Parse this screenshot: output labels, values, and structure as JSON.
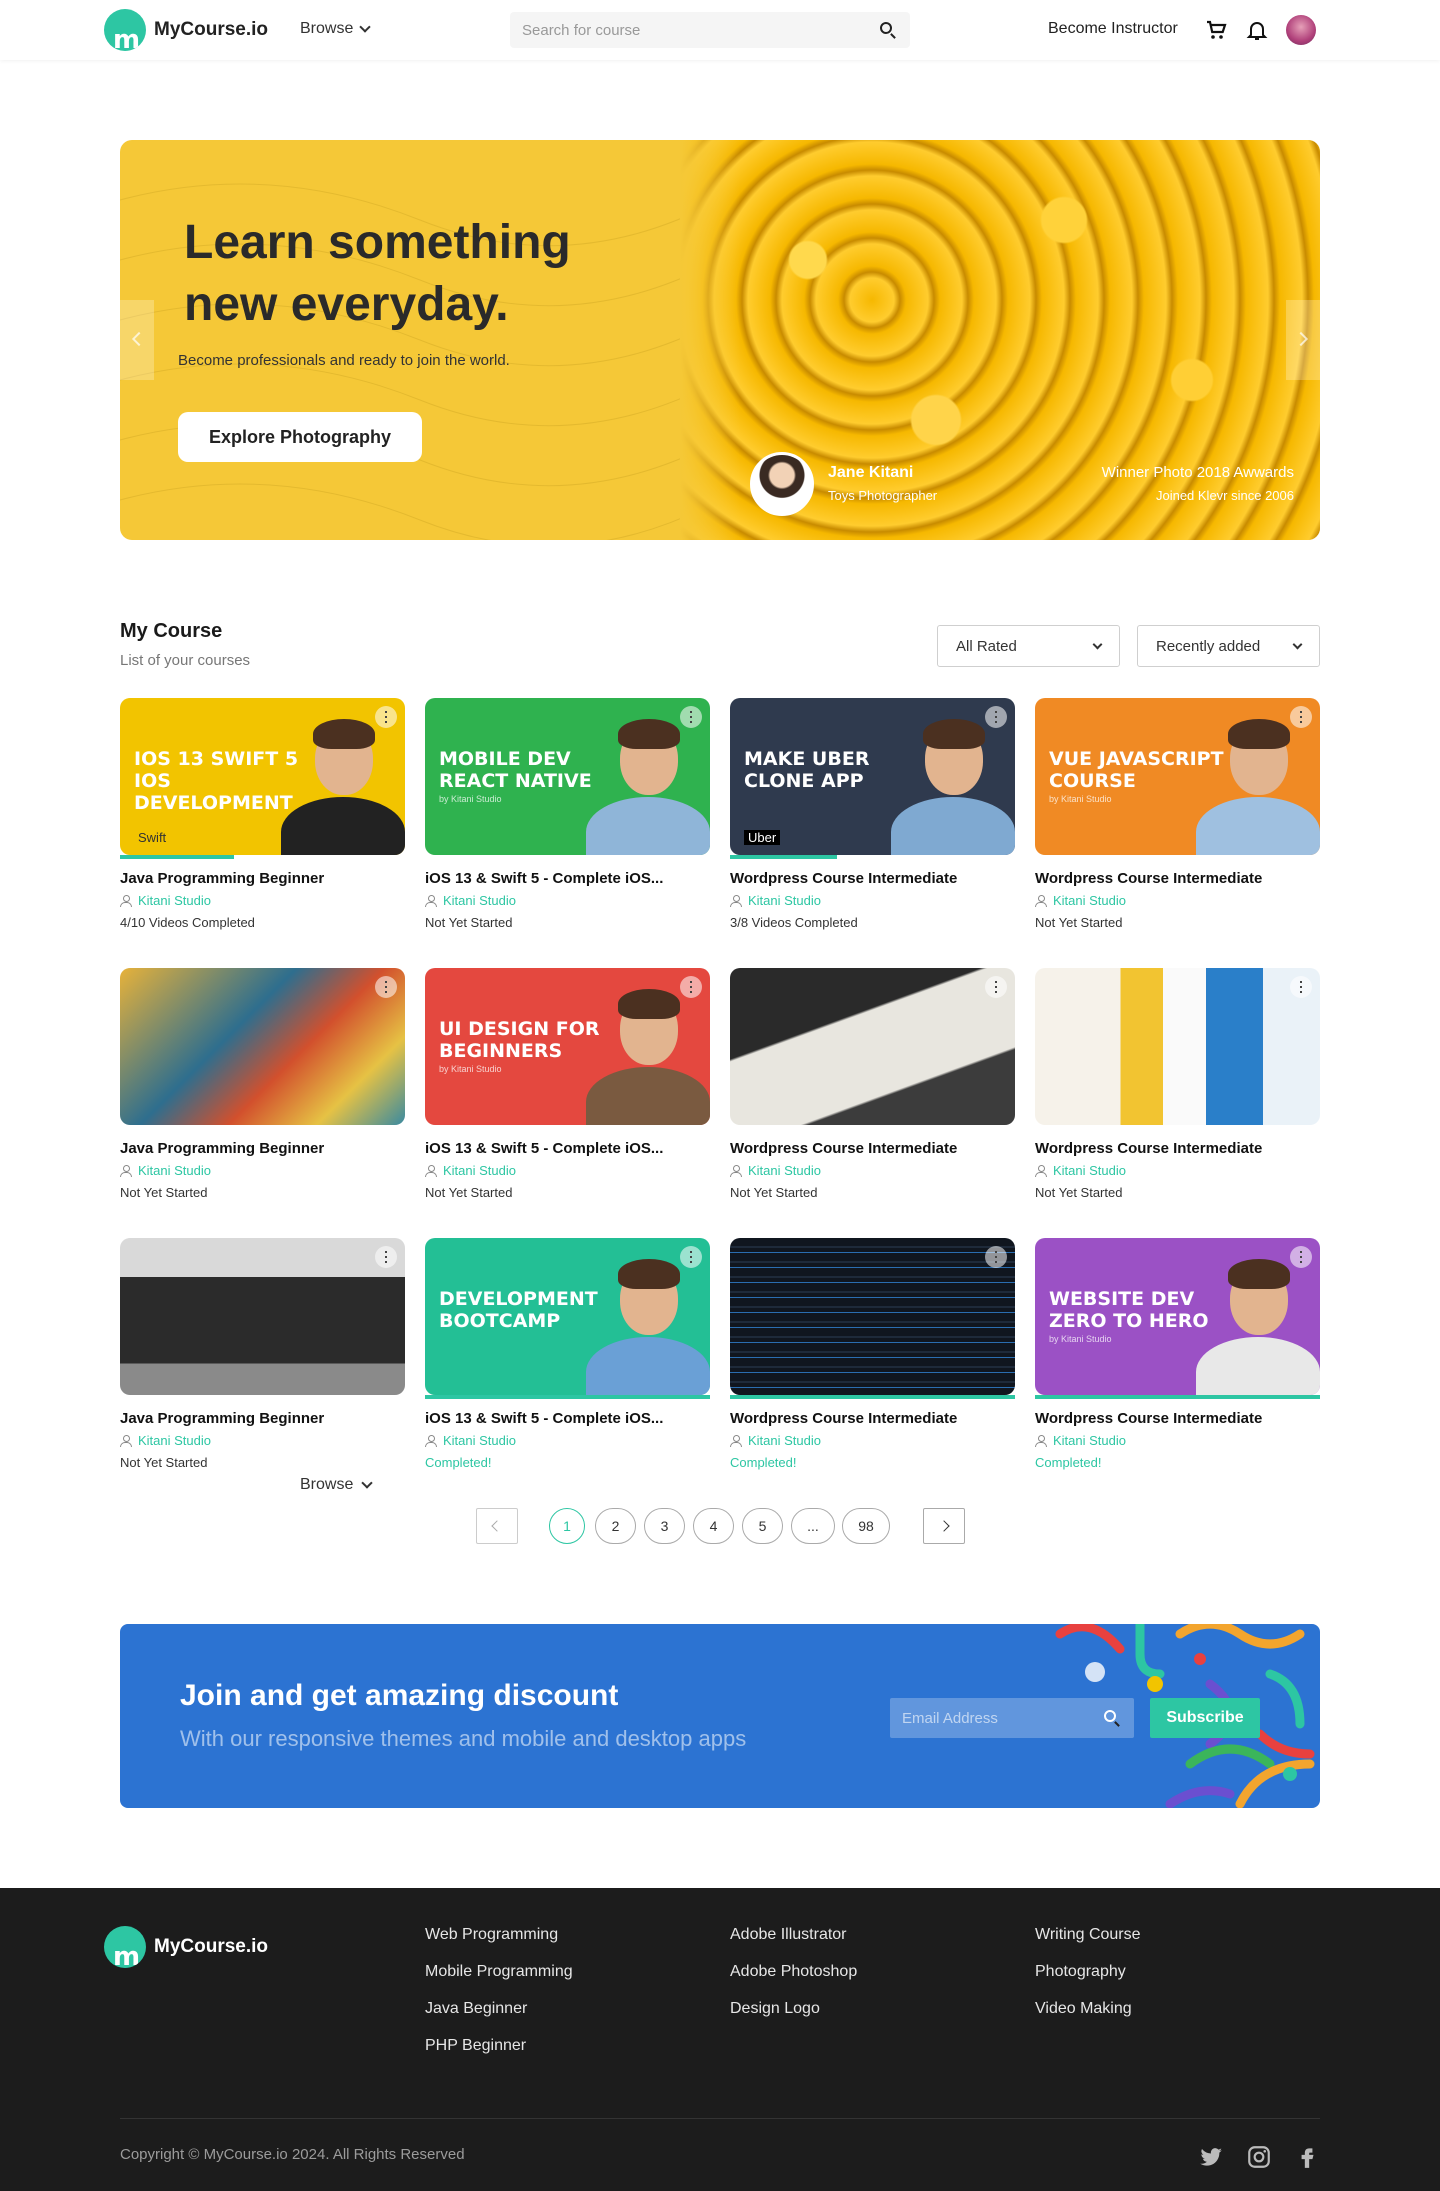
{
  "header": {
    "logo_text": "MyCourse.io",
    "browse_label": "Browse",
    "search_placeholder": "Search for course",
    "become_instructor": "Become Instructor"
  },
  "hero": {
    "headline": "Learn something new everyday.",
    "subtext": "Become professionals and ready to join the world.",
    "cta_label": "Explore Photography",
    "author_name": "Jane Kitani",
    "author_role": "Toys Photographer",
    "award": "Winner Photo 2018 Awwards",
    "joined": "Joined Klevr since 2006"
  },
  "my_course": {
    "title": "My Course",
    "subtitle": "List of your courses",
    "filter_rated": "All Rated",
    "filter_sort": "Recently added"
  },
  "courses": [
    {
      "title": "Java Programming Beginner",
      "author": "Kitani Studio",
      "status": "4/10 Videos Completed",
      "progress": 0.4,
      "thumb_text": "IOS 13 SWIFT 5 IOS DEVELOPMENT",
      "thumb_badge": "Swift",
      "thumb_color": "#f2c400"
    },
    {
      "title": "iOS 13 & Swift 5 - Complete iOS...",
      "author": "Kitani Studio",
      "status": "Not Yet Started",
      "progress": 0,
      "thumb_text": "MOBILE DEV REACT NATIVE",
      "thumb_studio": "by Kitani Studio",
      "thumb_color": "#2fb24f"
    },
    {
      "title": "Wordpress Course Intermediate",
      "author": "Kitani Studio",
      "status": "3/8 Videos Completed",
      "progress": 0.375,
      "thumb_text": "MAKE UBER CLONE APP",
      "thumb_badge": "Uber",
      "thumb_color": "#2f3a4e"
    },
    {
      "title": "Wordpress Course Intermediate",
      "author": "Kitani Studio",
      "status": "Not Yet Started",
      "progress": 0,
      "thumb_text": "VUE JAVASCRIPT COURSE",
      "thumb_studio": "by Kitani Studio",
      "thumb_color": "#f08a24"
    },
    {
      "title": "Java Programming Beginner",
      "author": "Kitani Studio",
      "status": "Not Yet Started",
      "progress": 0,
      "thumb_text": "",
      "thumb_color": "#c8862a"
    },
    {
      "title": "iOS 13 & Swift 5 - Complete iOS...",
      "author": "Kitani Studio",
      "status": "Not Yet Started",
      "progress": 0,
      "thumb_text": "UI DESIGN FOR BEGINNERS",
      "thumb_studio": "by Kitani Studio",
      "thumb_color": "#e4483f"
    },
    {
      "title": "Wordpress Course Intermediate",
      "author": "Kitani Studio",
      "status": "Not Yet Started",
      "progress": 0,
      "thumb_text": "",
      "thumb_color": "#3a3a3a"
    },
    {
      "title": "Wordpress Course Intermediate",
      "author": "Kitani Studio",
      "status": "Not Yet Started",
      "progress": 0,
      "thumb_text": "",
      "thumb_color": "#dfe7ee"
    },
    {
      "title": "Java Programming Beginner",
      "author": "Kitani Studio",
      "status": "Not Yet Started",
      "progress": 0,
      "thumb_text": "",
      "thumb_color": "#4a4a4a"
    },
    {
      "title": "iOS 13 & Swift 5 - Complete iOS...",
      "author": "Kitani Studio",
      "status": "Completed!",
      "progress": 1,
      "thumb_text": "DEVELOPMENT BOOTCAMP",
      "thumb_color": "#23bf95"
    },
    {
      "title": "Wordpress Course Intermediate",
      "author": "Kitani Studio",
      "status": "Completed!",
      "progress": 1,
      "thumb_text": "",
      "thumb_color": "#1a2130"
    },
    {
      "title": "Wordpress Course Intermediate",
      "author": "Kitani Studio",
      "status": "Completed!",
      "progress": 1,
      "thumb_text": "WEBSITE DEV ZERO TO HERO",
      "thumb_studio": "by Kitani Studio",
      "thumb_color": "#9b51c5"
    }
  ],
  "browse_bottom": "Browse",
  "pagination": {
    "pages": [
      "1",
      "2",
      "3",
      "4",
      "5",
      "...",
      "98"
    ],
    "current": "1"
  },
  "discount": {
    "title": "Join and get amazing discount",
    "subtitle": "With our responsive themes and mobile and desktop apps",
    "email_placeholder": "Email Address",
    "button": "Subscribe"
  },
  "footer": {
    "logo_text": "MyCourse.io",
    "col1": [
      "Web Programming",
      "Mobile Programming",
      "Java Beginner",
      "PHP Beginner"
    ],
    "col2": [
      "Adobe Illustrator",
      "Adobe Photoshop",
      "Design Logo"
    ],
    "col3": [
      "Writing Course",
      "Photography",
      "Video Making"
    ],
    "copyright": "Copyright © MyCourse.io 2024. All Rights Reserved",
    "social": [
      "twitter-icon",
      "instagram-icon",
      "facebook-icon"
    ]
  },
  "colors": {
    "accent": "#2dc6a3",
    "hero_bg": "#f5c837",
    "discount_bg": "#2c73d2",
    "footer_bg": "#1c1c1c"
  }
}
